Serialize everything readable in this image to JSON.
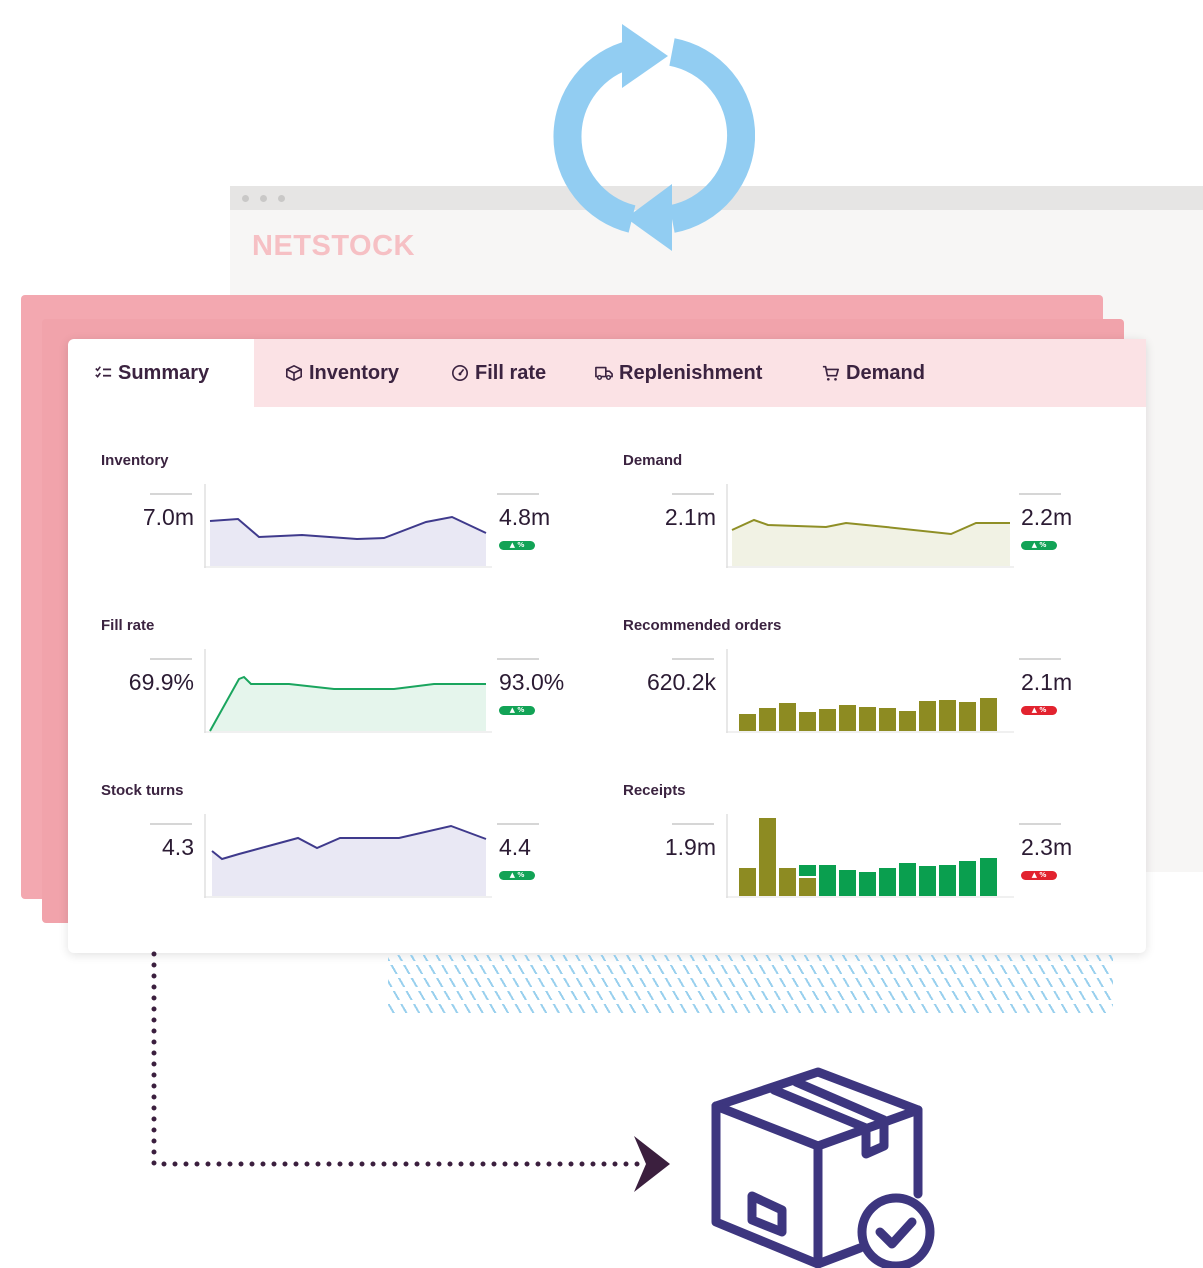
{
  "brand": {
    "logo_text": "NETSTOCK",
    "logo_color": "#f6c0c4"
  },
  "tabs": [
    {
      "label": "Summary",
      "icon": "checklist-icon",
      "active": true
    },
    {
      "label": "Inventory",
      "icon": "box-icon"
    },
    {
      "label": "Fill rate",
      "icon": "gauge-icon"
    },
    {
      "label": "Replenishment",
      "icon": "truck-icon"
    },
    {
      "label": "Demand",
      "icon": "cart-icon"
    }
  ],
  "metrics": {
    "inventory": {
      "title": "Inventory",
      "left_value": "7.0m",
      "right_value": "4.8m",
      "badge": "▲ %",
      "trend": "up"
    },
    "demand": {
      "title": "Demand",
      "left_value": "2.1m",
      "right_value": "2.2m",
      "badge": "▲ %",
      "trend": "up"
    },
    "fill_rate": {
      "title": "Fill rate",
      "left_value": "69.9%",
      "right_value": "93.0%",
      "badge": "▲ %",
      "trend": "up"
    },
    "recommended_orders": {
      "title": "Recommended orders",
      "left_value": "620.2k",
      "right_value": "2.1m",
      "badge": "▲ %",
      "trend": "down"
    },
    "stock_turns": {
      "title": "Stock turns",
      "left_value": "4.3",
      "right_value": "4.4",
      "badge": "▲ %",
      "trend": "up"
    },
    "receipts": {
      "title": "Receipts",
      "left_value": "1.9m",
      "right_value": "2.3m",
      "badge": "▲ %",
      "trend": "down"
    }
  },
  "colors": {
    "inventory_line": "#3f3a8c",
    "inventory_fill": "#e9e8f4",
    "demand_line": "#8f8f26",
    "demand_fill": "#f1f2e4",
    "fill_rate_line": "#1aa55e",
    "fill_rate_fill": "#e5f5ec",
    "bar_olive": "#8d8b22",
    "bar_green": "#0a9f4f",
    "badge_up": "#12a356",
    "badge_down": "#e2232f",
    "refresh_arrows": "#92cdf2",
    "box_outline": "#3d367f",
    "connector": "#3b1f3e"
  },
  "icons": {
    "refresh": "refresh-arrows-icon",
    "box": "package-check-icon",
    "arrow": "arrow-head-icon"
  }
}
